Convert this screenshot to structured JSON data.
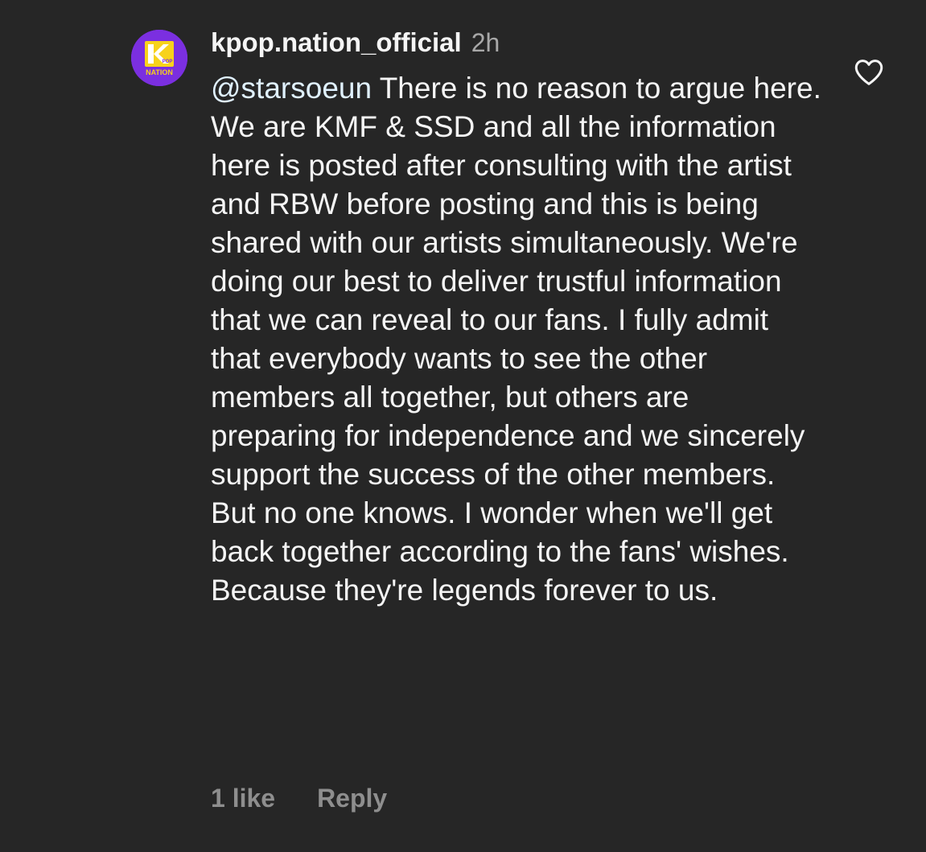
{
  "comment": {
    "avatar_icon": "kpop-nation-logo-icon",
    "avatar_color": "#7b2fe0",
    "logo_accent_color": "#f7d21b",
    "logo_text_pop": "POP",
    "logo_text_nation": "NATION",
    "username": "kpop.nation_official",
    "timestamp": "2h",
    "mention": "@starsoeun",
    "text": "There is no reason to argue here. We are KMF & SSD and all the information here is posted after consulting with the artist and RBW before posting and this is being shared with our artists simultaneously. We're doing our best to deliver trustful information that we can reveal to our fans. I fully admit that everybody wants to see the other members all together, but others are preparing for independence and we sincerely support the success of the other members. But no one knows. I wonder when we'll get back together according to the fans' wishes. Because they're legends forever to us.",
    "likes_label": "1 like",
    "reply_label": "Reply",
    "like_icon": "heart-outline-icon"
  }
}
